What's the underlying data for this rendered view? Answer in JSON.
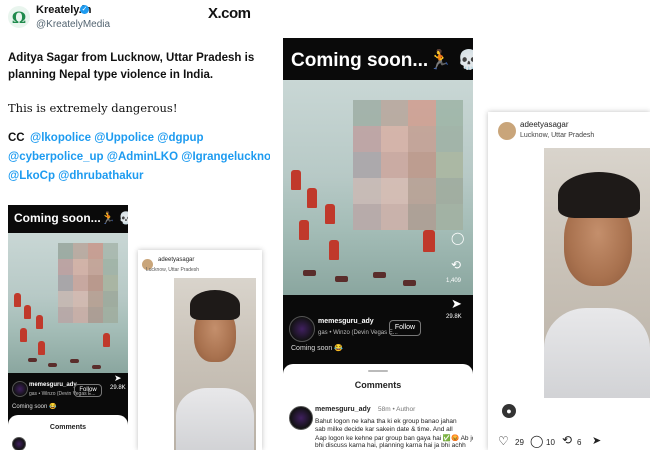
{
  "tweet": {
    "account_name": "Kreately.in",
    "account_handle": "@KreatelyMedia",
    "platform_logo": "X.com",
    "headline_lines": [
      "Aditya Sagar from Lucknow, Uttar Pradesh is",
      "planning Nepal type violence in India."
    ],
    "warning": "This is extremely dangerous!",
    "cc_prefix": "CC",
    "mention_lines": [
      "@lkopolice @Uppolice @dgpup",
      "@cyberpolice_up @AdminLKO @Igrangelucknow",
      "@LkoCp @dhrubathakur"
    ]
  },
  "reel_small": {
    "title": "Coming soon...🏃 💀",
    "username": "memesguru_ady",
    "audio": "gas • Winzo (Devin Vegas E...",
    "follow_label": "Follow",
    "likes": "29.8K",
    "caption": "Coming soon 😂",
    "comments_header": "Comments"
  },
  "reel_large": {
    "title": "Coming soon...🏃 💀",
    "username": "memesguru_ady",
    "audio": "gas • Winzo (Devin Vegas E...",
    "follow_label": "Follow",
    "share_count": "1,409",
    "likes": "29.8K",
    "caption": "Coming soon 😂",
    "comments_header": "Comments",
    "comment_user": "memesguru_ady",
    "comment_meta": "58m • Author",
    "comment_lines": [
      "Bahut logon ne kaha tha ki ek group banao jahan",
      "sab milke decide kar sakein date & time. And all",
      "Aap logon ke kehne par group ban gaya hai ✅😡 Ab jo",
      "bhi discuss karna hai, planning karna hai ja bhi achh"
    ]
  },
  "profile_small": {
    "username": "adeetyasagar",
    "location": "Lucknow, Uttar Pradesh"
  },
  "profile_large": {
    "username": "adeetyasagar",
    "location": "Lucknow, Uttar Pradesh",
    "likes_count": "29",
    "comments_count": "10",
    "reposts_count": "6"
  }
}
